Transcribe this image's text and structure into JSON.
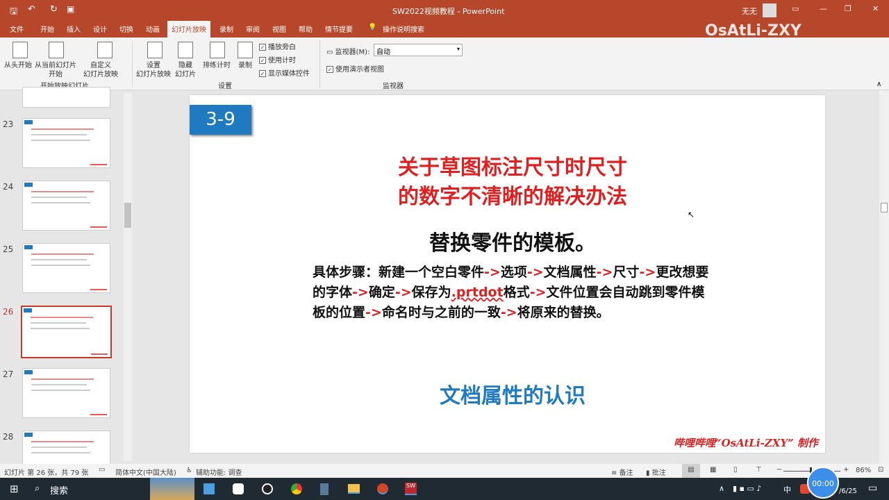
{
  "window": {
    "title": "SW2022视频教程 - PowerPoint",
    "user": "无无",
    "watermark": "OsAtLi-ZXY"
  },
  "tabs": [
    "文件",
    "开始",
    "插入",
    "设计",
    "切换",
    "动画",
    "幻灯片放映",
    "录制",
    "审阅",
    "视图",
    "帮助",
    "情节提要",
    "操作说明搜索"
  ],
  "ribbon": {
    "from_start": "从头开始",
    "from_current": "从当前幻灯片\n开始",
    "custom": "自定义\n幻灯片放映",
    "group1": "开始放映幻灯片",
    "setup": "设置\n幻灯片放映",
    "hide": "隐藏\n幻灯片",
    "rehearse": "排练计时",
    "record": "录制",
    "chk_narration": "播放旁白",
    "chk_timings": "使用计时",
    "chk_media": "显示媒体控件",
    "group2": "设置",
    "monitor_label": "监视器(M):",
    "monitor_value": "自动",
    "presenter_view": "使用演示者视图",
    "group3": "监视器"
  },
  "thumbnails": [
    {
      "num": "23"
    },
    {
      "num": "24"
    },
    {
      "num": "25"
    },
    {
      "num": "26",
      "selected": true
    },
    {
      "num": "27"
    },
    {
      "num": "28"
    }
  ],
  "slide": {
    "badge": "3-9",
    "title_line1": "关于草图标注尺寸时尺寸",
    "title_line2": "的数字不清晰的解决办法",
    "subtitle": "替换零件的模板。",
    "steps": [
      "具体步骤：新建一个空白零件",
      "->",
      "选项",
      "->",
      "文档属性",
      "->",
      "尺寸",
      "->",
      "更改想要的字体",
      "->",
      "确定",
      "->",
      "保存为",
      ".prtdot",
      "格式",
      "->",
      "文件位置会自动跳到零件模板的位置",
      "->",
      "命名时与之前的一致",
      "->",
      "将原来的替换。"
    ],
    "link": "文档属性的认识",
    "footer": "哔哩哔哩“OsAtLi-ZXY” 制作"
  },
  "status": {
    "slide_info": "幻灯片 第 26 张，共 79 张",
    "language": "简体中文(中国大陆)",
    "accessibility": "辅助功能: 调查",
    "notes": "备注",
    "comments": "批注",
    "zoom": "86%"
  },
  "taskbar": {
    "search": "搜索",
    "ime": "中",
    "timer": "00:00",
    "date": "/6/25"
  },
  "colors": {
    "accent": "#b7472a",
    "title_red": "#e02020",
    "link_blue": "#1f7ac0",
    "badge": "#1f7ac0"
  }
}
